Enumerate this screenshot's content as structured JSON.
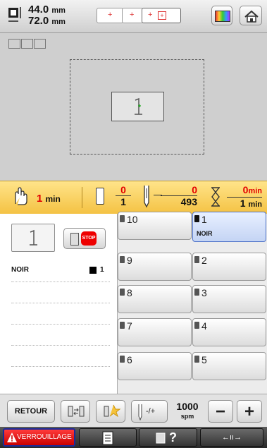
{
  "header": {
    "width_value": "44.0",
    "height_value": "72.0",
    "unit": "mm"
  },
  "timebar": {
    "elapsed_value": "1",
    "elapsed_unit": "min",
    "color_current": "0",
    "color_total": "1",
    "stitch_current": "0",
    "stitch_total": "493",
    "time_current": "0",
    "time_total": "1",
    "time_unit": "min"
  },
  "color_list": [
    {
      "name": "NOIR",
      "index": "1"
    }
  ],
  "stop_label": "STOP",
  "thread_slots": [
    {
      "number": "10",
      "name": "",
      "selected": false
    },
    {
      "number": "1",
      "name": "NOIR",
      "selected": true
    },
    {
      "number": "9",
      "name": "",
      "selected": false
    },
    {
      "number": "2",
      "name": "",
      "selected": false
    },
    {
      "number": "8",
      "name": "",
      "selected": false
    },
    {
      "number": "3",
      "name": "",
      "selected": false
    },
    {
      "number": "7",
      "name": "",
      "selected": false
    },
    {
      "number": "4",
      "name": "",
      "selected": false
    },
    {
      "number": "6",
      "name": "",
      "selected": false
    },
    {
      "number": "5",
      "name": "",
      "selected": false
    }
  ],
  "toolbar": {
    "retour_label": "RETOUR",
    "needle_label": "-/+",
    "speed_value": "1000",
    "speed_unit": "spm",
    "minus_label": "−",
    "plus_label": "+"
  },
  "footer": {
    "lock_label": "VERROUILLAGE",
    "help_label": "?",
    "move_label": "←ıı→"
  },
  "colors": {
    "accent_red": "#e30000",
    "selected_slot": "#c4d4f4",
    "timebar": "#f4c243"
  }
}
